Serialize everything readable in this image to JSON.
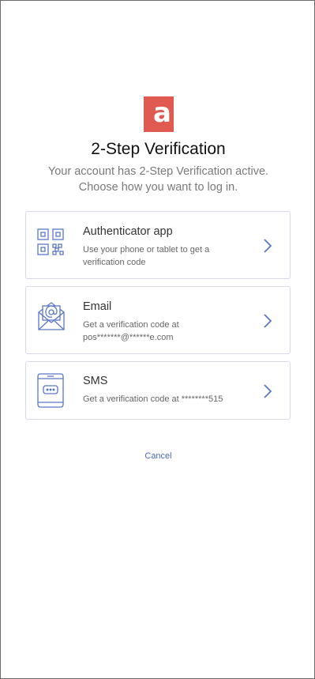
{
  "logo": {
    "letter": "a",
    "color": "#e05a52"
  },
  "page": {
    "title": "2-Step Verification",
    "subtitle_line1": "Your account has 2-Step Verification active.",
    "subtitle_line2": "Choose how you want to log in."
  },
  "options": [
    {
      "icon": "qr-code-icon",
      "title": "Authenticator app",
      "desc_line1": "Use your phone or tablet to get a",
      "desc_line2": "verification code"
    },
    {
      "icon": "envelope-at-icon",
      "title": "Email",
      "desc_line1": "Get a verification code at",
      "desc_line2": "pos*******@******e.com"
    },
    {
      "icon": "mobile-phone-icon",
      "title": "SMS",
      "desc_line1": "Get a verification code at ********515"
    }
  ],
  "cancel_label": "Cancel",
  "colors": {
    "accent": "#4a6bbf",
    "icon_stroke": "#5a76c8",
    "card_border": "#d7d9e6"
  }
}
